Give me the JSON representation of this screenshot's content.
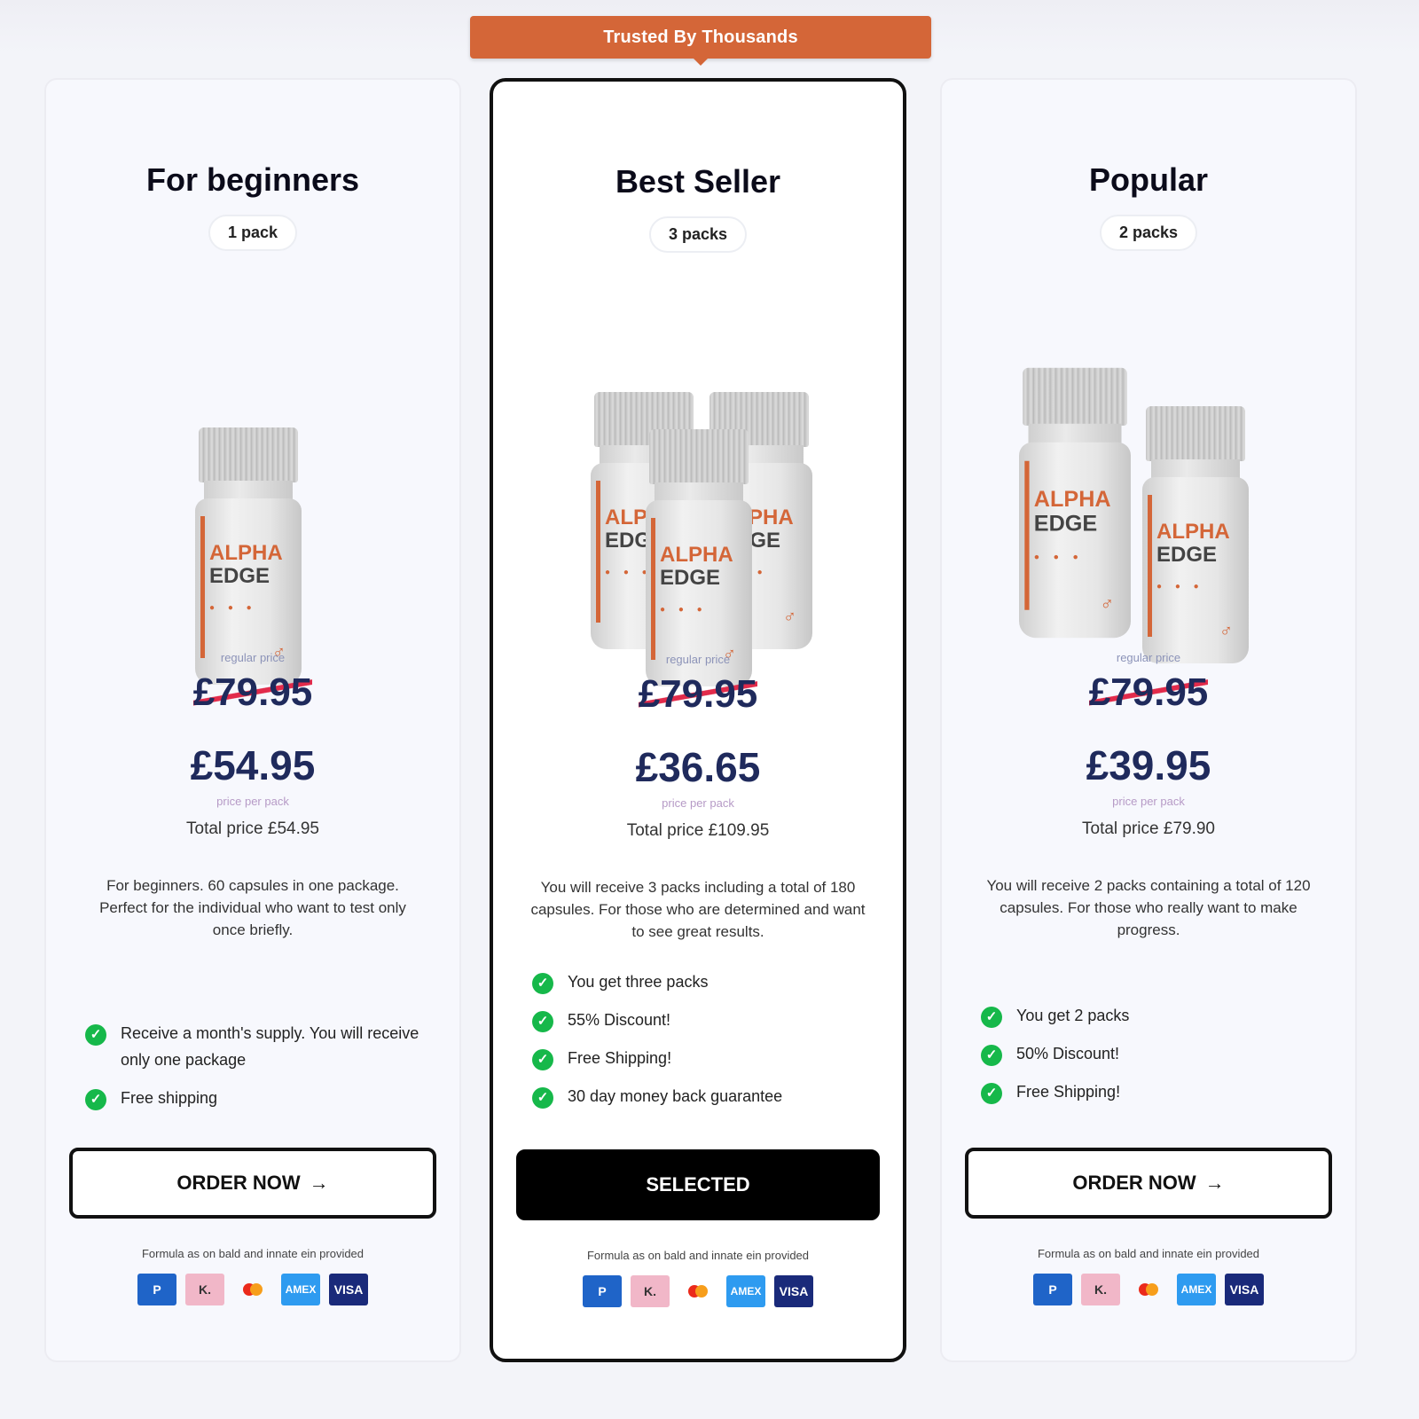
{
  "ribbon": "Trusted By Thousands",
  "cards": [
    {
      "title": "For beginners",
      "packs": "1 pack",
      "regular_label": "regular price",
      "regular_price": "£79.95",
      "price": "£54.95",
      "per_pack": "price per pack",
      "total": "Total price £54.95",
      "description": "For beginners. 60 capsules in one package. Perfect for the individual who want to test only once briefly.",
      "features": [
        "Receive a month's supply. You will receive only one package",
        "Free shipping"
      ],
      "button": "ORDER NOW",
      "button_arrow": "→",
      "formula_note": "Formula as on bald and innate ein provided",
      "payments": [
        "P",
        "K.",
        "",
        "AMEX",
        "VISA"
      ]
    },
    {
      "title": "Best Seller",
      "packs": "3 packs",
      "regular_label": "regular price",
      "regular_price": "£79.95",
      "price": "£36.65",
      "per_pack": "price per pack",
      "total": "Total price £109.95",
      "description": "You will receive 3 packs including a total of 180 capsules. For those who are determined and want to see great results.",
      "features": [
        "You get three packs",
        "55% Discount!",
        "Free Shipping!",
        "30 day money back guarantee"
      ],
      "button": "SELECTED",
      "button_arrow": "",
      "formula_note": "Formula as on bald and innate ein provided",
      "payments": [
        "P",
        "K.",
        "",
        "AMEX",
        "VISA"
      ]
    },
    {
      "title": "Popular",
      "packs": "2 packs",
      "regular_label": "regular price",
      "regular_price": "£79.95",
      "price": "£39.95",
      "per_pack": "price per pack",
      "total": "Total price £79.90",
      "description": "You will receive 2 packs containing a total of 120 capsules. For those who really want to make progress.",
      "features": [
        "You get 2 packs",
        "50% Discount!",
        "Free Shipping!"
      ],
      "button": "ORDER NOW",
      "button_arrow": "→",
      "formula_note": "Formula as on bald and innate ein provided",
      "payments": [
        "P",
        "K.",
        "",
        "AMEX",
        "VISA"
      ]
    }
  ],
  "bottle_label": {
    "line1": "ALPHA",
    "line2": "EDGE"
  },
  "colors": {
    "accent": "#d46638",
    "price": "#1f2a5c",
    "check": "#16b84a",
    "strike": "#e22b4b"
  },
  "icons": {
    "check": "check-circle-icon",
    "arrow": "arrow-right-icon"
  }
}
